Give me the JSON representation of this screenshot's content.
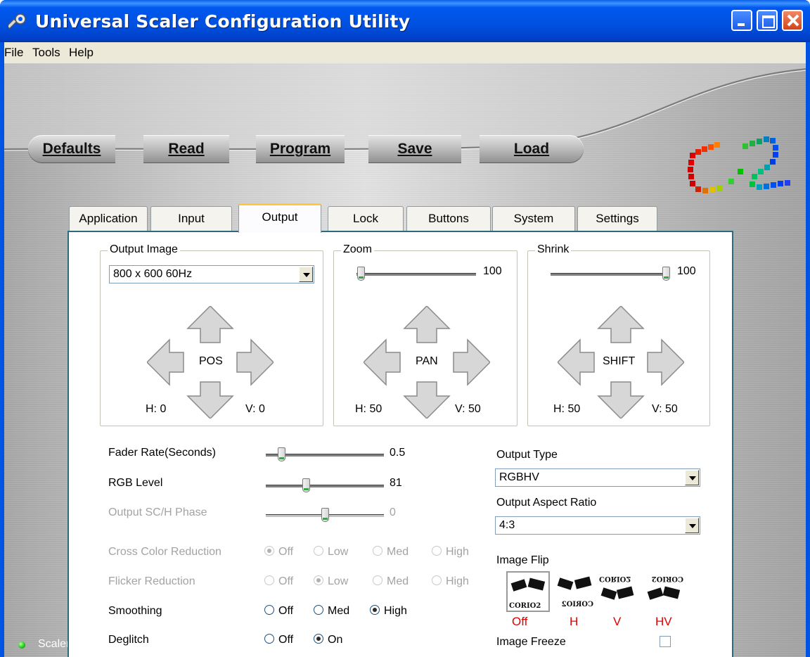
{
  "window": {
    "title": "Universal Scaler Configuration Utility"
  },
  "menu": [
    "File",
    "Tools",
    "Help"
  ],
  "toolbar": {
    "buttons": [
      "Defaults",
      "Read",
      "Program",
      "Save",
      "Load"
    ]
  },
  "tabs": [
    "Application",
    "Input",
    "Output",
    "Lock",
    "Buttons",
    "System",
    "Settings"
  ],
  "active_tab": "Output",
  "output_image": {
    "group_label": "Output Image",
    "resolution": "800 x 600 60Hz",
    "pad_label": "POS",
    "h": "H: 0",
    "v": "V: 0"
  },
  "zoom": {
    "group_label": "Zoom",
    "value": "100",
    "level_fraction": 0.0,
    "pad_label": "PAN",
    "h": "H: 50",
    "v": "V: 50"
  },
  "shrink": {
    "group_label": "Shrink",
    "value": "100",
    "level_fraction": 1.0,
    "pad_label": "SHIFT",
    "h": "H: 50",
    "v": "V: 50"
  },
  "sliders": [
    {
      "label": "Fader Rate(Seconds)",
      "value": "0.5",
      "level_fraction": 0.1,
      "disabled": false
    },
    {
      "label": "RGB Level",
      "value": "81",
      "level_fraction": 0.33,
      "disabled": false
    },
    {
      "label": "Output SC/H Phase",
      "value": "0",
      "level_fraction": 0.5,
      "disabled": true
    }
  ],
  "radios": [
    {
      "label": "Cross Color Reduction",
      "options": [
        "Off",
        "Low",
        "Med",
        "High"
      ],
      "selected": "Off",
      "disabled": true
    },
    {
      "label": "Flicker Reduction",
      "options": [
        "Off",
        "Low",
        "Med",
        "High"
      ],
      "selected": "Low",
      "disabled": true
    },
    {
      "label": "Smoothing",
      "options": [
        "Off",
        "Med",
        "High"
      ],
      "selected": "High",
      "disabled": false
    },
    {
      "label": "Deglitch",
      "options": [
        "Off",
        "On"
      ],
      "selected": "On",
      "disabled": false
    }
  ],
  "output_type": {
    "label": "Output Type",
    "value": "RGBHV"
  },
  "aspect_ratio": {
    "label": "Output Aspect Ratio",
    "value": "4:3"
  },
  "image_flip": {
    "label": "Image Flip",
    "options": [
      "Off",
      "H",
      "V",
      "HV"
    ],
    "selected": "Off",
    "logo_text": "CORIO2"
  },
  "image_freeze": {
    "label": "Image Freeze",
    "checked": false
  },
  "status": {
    "text": "Scaler ON-Line",
    "led_color": "#16c316"
  }
}
